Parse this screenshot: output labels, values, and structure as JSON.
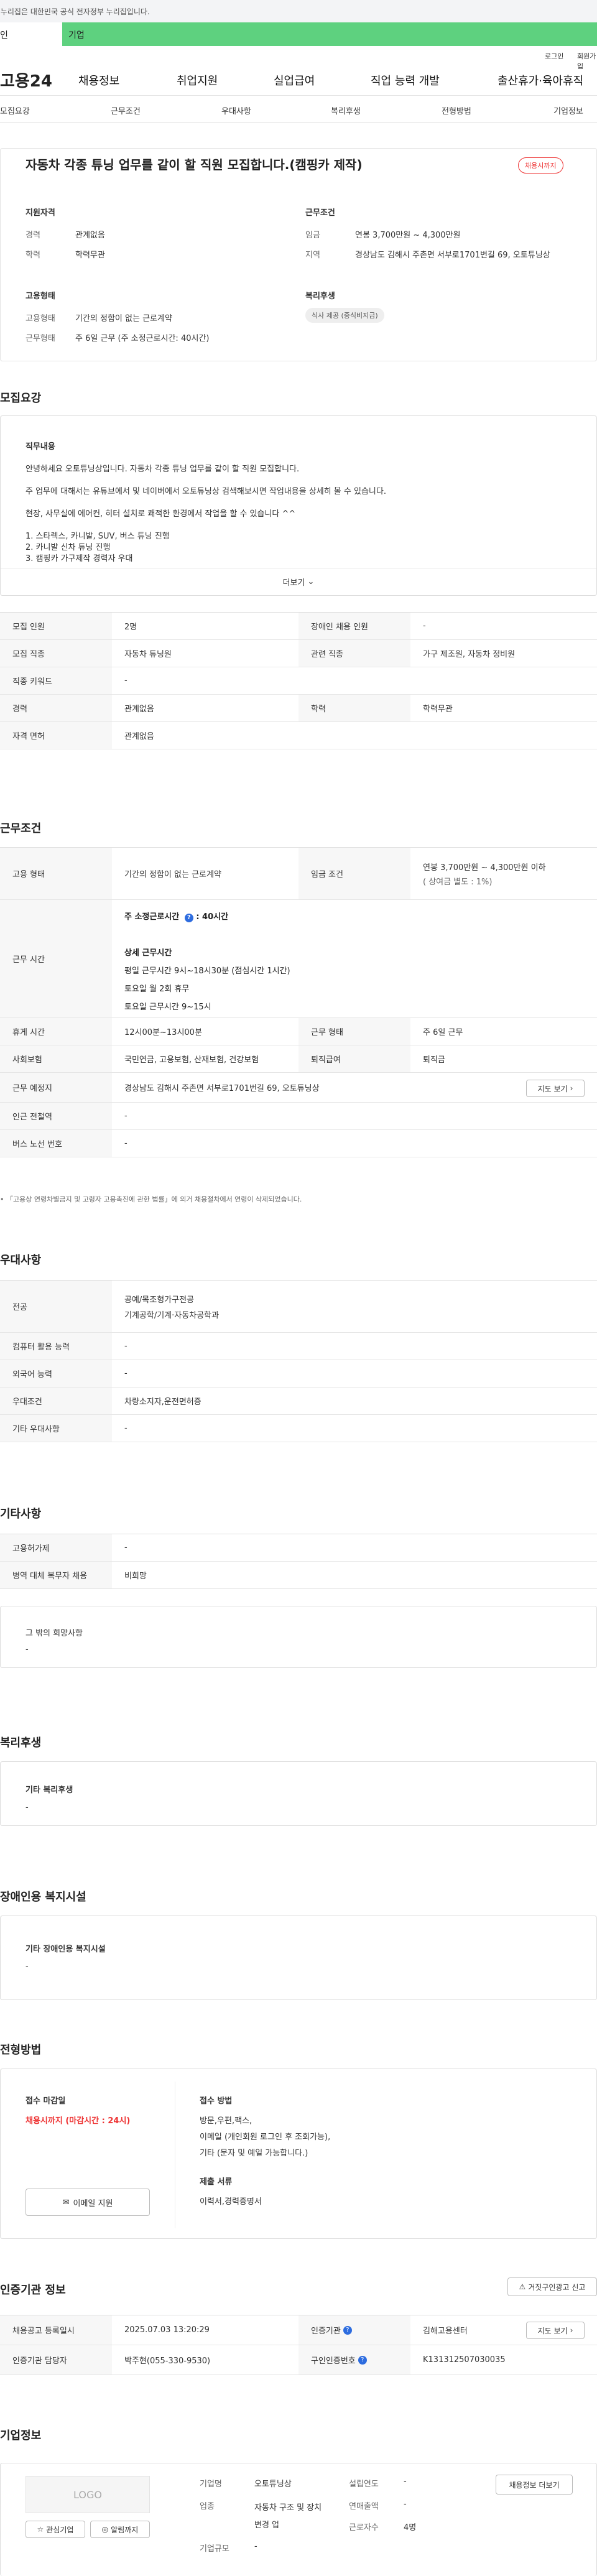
{
  "gov_notice": "이 누리집은 대한민국 공식 전자정부 누리집입니다.",
  "ad_left": "인",
  "ad_right": "기업",
  "util": {
    "login": "로그인",
    "join": "회원가입"
  },
  "gnb": {
    "logo": "고용24",
    "menus": [
      "채용정보",
      "취업지원",
      "실업급여",
      "직업 능력 개발",
      "출산휴가·육아휴직"
    ]
  },
  "subtabs": [
    "모집요강",
    "근무조건",
    "우대사항",
    "복리후생",
    "전형방법",
    "기업정보"
  ],
  "job": {
    "title": "자동차 각종 튜닝 업무를 같이 할 직원 모집합니다.(캠핑카 제작)",
    "status_badge": "채용시까지"
  },
  "summary": {
    "qual_title": "지원자격",
    "career_k": "경력",
    "career_v": "관계없음",
    "edu_k": "학력",
    "edu_v": "학력무관",
    "cond_title": "근무조건",
    "wage_k": "임금",
    "wage_v": "연봉 3,700만원 ~ 4,300만원",
    "area_k": "지역",
    "area_v": "경상남도 김해시 주촌면 서부로1701번길 69, 오토튜닝상",
    "emp_title": "고용형태",
    "emp_k": "고용형태",
    "emp_v": "기간의 정함이 없는 근로계약",
    "work_k": "근무형태",
    "work_v": "주 6일 근무 (주 소정근로시간: 40시간)",
    "welfare_title": "복리후생",
    "welfare_chip": "식사 제공 (중식비지급)"
  },
  "recruit": {
    "section_title": "모집요강",
    "duty_title": "직무내용",
    "lines": [
      "안녕하세요 오토튜닝상입니다.  자동차 각종 튜닝 업무를 같이 할 직원 모집합니다.",
      "주 업무에 대해서는 유튜브에서 및 네이버에서 오토튜닝상 검색해보시면 작업내용을 상세히 볼 수 있습니다.",
      "현장, 사무실에 에어컨, 히터 설치로 쾌적한 환경에서 작업을 할 수 있습니다 ^^",
      "1. 스타렉스, 카니발, SUV, 버스 튜닝 진행",
      "2. 카니발 신차 튜닝 진행",
      "3. 캠핑카 가구제작 경력자 우대"
    ],
    "more": "더보기",
    "rows": [
      {
        "k1": "모집 인원",
        "v1": "2명",
        "k2": "장애인 채용 인원",
        "v2": "-"
      },
      {
        "k1": "모집 직종",
        "v1": "자동차 튜닝원",
        "k2": "관련 직종",
        "v2": "가구 제조원, 자동차 정비원"
      },
      {
        "k1": "직종 키워드",
        "v1": "-"
      },
      {
        "k1": "경력",
        "v1": "관계없음",
        "k2": "학력",
        "v2": "학력무관"
      },
      {
        "k1": "자격 면허",
        "v1": "관계없음"
      }
    ]
  },
  "work": {
    "section_title": "근무조건",
    "emp_k": "고용 형태",
    "emp_v": "기간의 정함이 없는 근로계약",
    "wage_k": "임금 조건",
    "wage_v": "연봉 3,700만원 ~ 4,300만원 이하",
    "wage_sub": "( 상여금 별도 : 1%)",
    "hours_k": "근무 시간",
    "hours_total": "주 소정근로시간",
    "hours_total_v": ": 40시간",
    "hours_detail_title": "상세 근무시간",
    "hours_lines": [
      "평일 근무시간 9시~18시30분 (점심시간 1시간)",
      "토요일 월 2회 휴무",
      "토요일 근무시간 9~15시"
    ],
    "break_k": "휴게 시간",
    "break_v": "12시00분~13시00분",
    "type_k": "근무 형태",
    "type_v": "주 6일 근무",
    "ins_k": "사회보험",
    "ins_v": "국민연금, 고용보험, 산재보험, 건강보험",
    "ret_k": "퇴직급여",
    "ret_v": "퇴직금",
    "place_k": "근무 예정지",
    "place_v": "경상남도 김해시 주촌면 서부로1701번길 69, 오토튜닝상",
    "map_btn": "지도 보기",
    "subway_k": "인근 전철역",
    "subway_v": "-",
    "bus_k": "버스 노선 번호",
    "bus_v": "-",
    "note": "「고용상 연령차별금지 및 고령자 고용촉진에 관한 법률」에 의거 채용절차에서 연령이 삭제되었습니다."
  },
  "pref": {
    "section_title": "우대사항",
    "rows": [
      {
        "k": "전공",
        "v": "공예/목조형가구전공",
        "v2": "기계공학/기계·자동차공학과"
      },
      {
        "k": "컴퓨터 활용 능력",
        "v": "-"
      },
      {
        "k": "외국어 능력",
        "v": "-"
      },
      {
        "k": "우대조건",
        "v": "차량소지자,운전면허증"
      },
      {
        "k": "기타 우대사항",
        "v": "-"
      }
    ]
  },
  "etc": {
    "section_title": "기타사항",
    "rows": [
      {
        "k": "고용허가제",
        "v": "-"
      },
      {
        "k": "병역 대체 복무자 채용",
        "v": "비희망"
      }
    ],
    "hope_title": "그 밖의 희망사항",
    "hope_v": "-"
  },
  "welfare": {
    "section_title": "복리후생",
    "box_title": "기타 복리후생",
    "box_v": "-"
  },
  "disabled": {
    "section_title": "장애인용 복지시설",
    "box_title": "기타 장애인용 복지시설",
    "box_v": "-"
  },
  "process": {
    "section_title": "전형방법",
    "deadline_title": "접수 마감일",
    "deadline_v": "채용시까지 (마감시간 : 24시)",
    "apply_btn": "이메일 지원",
    "method_title": "접수 방법",
    "method_lines": [
      "방문,우편,팩스,",
      "이메일 (개인회원 로그인 후 조회가능),",
      "기타 (문자 및 예일 가능합니다.)"
    ],
    "docs_title": "제출 서류",
    "docs_v": "이력서,경력증명서"
  },
  "cert": {
    "section_title": "인증기관 정보",
    "report_btn": "거짓구인광고 신고",
    "reg_k": "채용공고 등록일시",
    "reg_v": "2025.07.03 13:20:29",
    "org_k": "인증기관",
    "org_v": "김해고용센터",
    "map_btn": "지도 보기",
    "mgr_k": "인증기관 담당자",
    "mgr_v": "박주현(055-330-9530)",
    "no_k": "구인인증번호",
    "no_v": "K131312507030035"
  },
  "company": {
    "section_title": "기업정보",
    "logo": "LOGO",
    "fav_btn": "관심기업",
    "alarm_btn": "알림까지",
    "name_k": "기업명",
    "name_v": "오토튜닝상",
    "biz_k": "업종",
    "biz_v": "자동차 구조 및 장치 변경 업",
    "scale_k": "기업규모",
    "scale_v": "-",
    "year_k": "설립연도",
    "year_v": "-",
    "sales_k": "연매출액",
    "sales_v": "-",
    "staff_k": "근로자수",
    "staff_v": "4명",
    "more_btn": "채용정보 더보기"
  }
}
